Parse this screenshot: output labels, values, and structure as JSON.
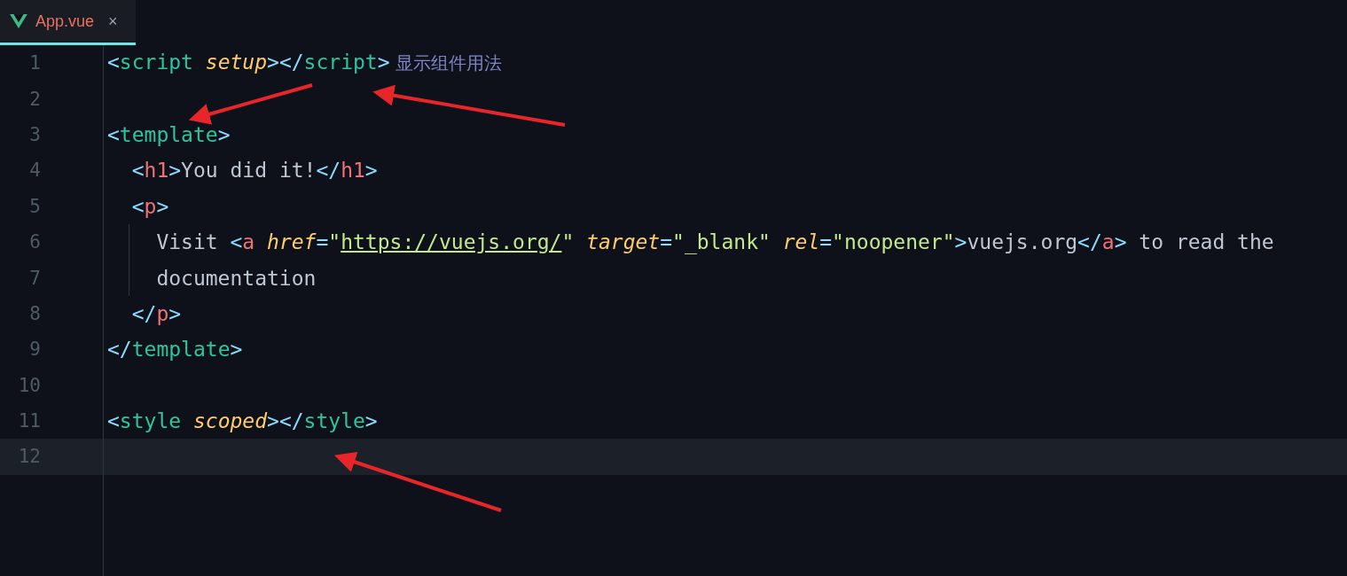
{
  "tabs": [
    {
      "label": "App.vue",
      "selected": true,
      "close": "×"
    }
  ],
  "lines": [
    {
      "number": "1",
      "current": false,
      "guide": false,
      "tokens": [
        {
          "kind": "punct",
          "text": "<"
        },
        {
          "kind": "tag",
          "text": "script"
        },
        {
          "kind": "attr",
          "text": " setup"
        },
        {
          "kind": "punct",
          "text": "></"
        },
        {
          "kind": "tag",
          "text": "script"
        },
        {
          "kind": "punct",
          "text": ">"
        },
        {
          "kind": "comment",
          "text": " 显示组件用法"
        }
      ]
    },
    {
      "number": "2",
      "current": false,
      "guide": false
    },
    {
      "number": "3",
      "current": false,
      "guide": false,
      "tokens": [
        {
          "kind": "punct",
          "text": "<"
        },
        {
          "kind": "tag",
          "text": "template"
        },
        {
          "kind": "punct",
          "text": ">"
        }
      ]
    },
    {
      "number": "4",
      "current": false,
      "guide": false,
      "tokens": [
        {
          "kind": "punct",
          "text": "  <"
        },
        {
          "kind": "element",
          "text": "h1"
        },
        {
          "kind": "punct",
          "text": ">"
        },
        {
          "kind": "plain",
          "text": "You did it!"
        },
        {
          "kind": "punct",
          "text": "</"
        },
        {
          "kind": "element",
          "text": "h1"
        },
        {
          "kind": "punct",
          "text": ">"
        }
      ]
    },
    {
      "number": "5",
      "current": false,
      "guide": false,
      "tokens": [
        {
          "kind": "punct",
          "text": "  <"
        },
        {
          "kind": "element",
          "text": "p"
        },
        {
          "kind": "punct",
          "text": ">"
        }
      ]
    },
    {
      "number": "6",
      "current": false,
      "guide": true,
      "tokens": [
        {
          "kind": "plain",
          "text": "    Visit "
        },
        {
          "kind": "punct",
          "text": "<"
        },
        {
          "kind": "element",
          "text": "a"
        },
        {
          "kind": "attr",
          "text": " href"
        },
        {
          "kind": "punct",
          "text": "="
        },
        {
          "kind": "string",
          "text": "\""
        },
        {
          "kind": "link",
          "text": "https://vuejs.org/"
        },
        {
          "kind": "string",
          "text": "\""
        },
        {
          "kind": "attr",
          "text": " target"
        },
        {
          "kind": "punct",
          "text": "="
        },
        {
          "kind": "string",
          "text": "\"_blank\""
        },
        {
          "kind": "attr",
          "text": " rel"
        },
        {
          "kind": "punct",
          "text": "="
        },
        {
          "kind": "string",
          "text": "\"noopener\""
        },
        {
          "kind": "punct",
          "text": ">"
        },
        {
          "kind": "plain",
          "text": "vuejs.org"
        },
        {
          "kind": "punct",
          "text": "</"
        },
        {
          "kind": "element",
          "text": "a"
        },
        {
          "kind": "punct",
          "text": ">"
        },
        {
          "kind": "plain",
          "text": " to read the"
        }
      ]
    },
    {
      "number": "7",
      "current": false,
      "guide": true,
      "tokens": [
        {
          "kind": "plain",
          "text": "    documentation"
        }
      ]
    },
    {
      "number": "8",
      "current": false,
      "guide": false,
      "tokens": [
        {
          "kind": "punct",
          "text": "  </"
        },
        {
          "kind": "element",
          "text": "p"
        },
        {
          "kind": "punct",
          "text": ">"
        }
      ]
    },
    {
      "number": "9",
      "current": false,
      "guide": false,
      "tokens": [
        {
          "kind": "punct",
          "text": "</"
        },
        {
          "kind": "tag",
          "text": "template"
        },
        {
          "kind": "punct",
          "text": ">"
        }
      ]
    },
    {
      "number": "10",
      "current": false,
      "guide": false
    },
    {
      "number": "11",
      "current": false,
      "guide": false,
      "tokens": [
        {
          "kind": "punct",
          "text": "<"
        },
        {
          "kind": "tag",
          "text": "style"
        },
        {
          "kind": "attr",
          "text": " scoped"
        },
        {
          "kind": "punct",
          "text": "></"
        },
        {
          "kind": "tag",
          "text": "style"
        },
        {
          "kind": "punct",
          "text": ">"
        }
      ]
    },
    {
      "number": "12",
      "current": true,
      "guide": false
    }
  ]
}
